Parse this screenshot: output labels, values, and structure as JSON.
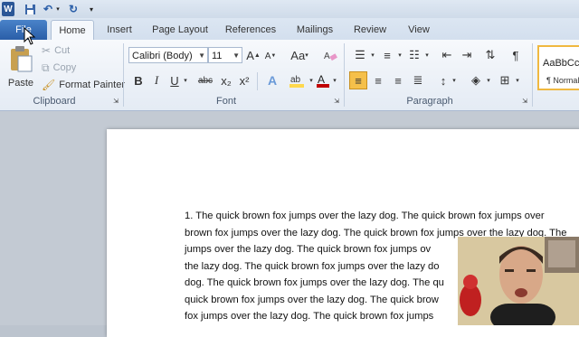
{
  "qat": {
    "app_icon": "W",
    "save_icon": "save-icon",
    "undo_icon": "undo-icon",
    "redo_icon": "redo-icon",
    "customize_icon": "customize-icon"
  },
  "tabs": [
    {
      "label": "File"
    },
    {
      "label": "Home"
    },
    {
      "label": "Insert"
    },
    {
      "label": "Page Layout"
    },
    {
      "label": "References"
    },
    {
      "label": "Mailings"
    },
    {
      "label": "Review"
    },
    {
      "label": "View"
    }
  ],
  "clipboard": {
    "paste": "Paste",
    "cut": "Cut",
    "copy": "Copy",
    "format_painter": "Format Painter",
    "group": "Clipboard"
  },
  "font": {
    "family": "Calibri (Body)",
    "size": "11",
    "group": "Font",
    "bold": "B",
    "italic": "I",
    "underline": "U",
    "strike": "abc",
    "subscript": "x₂",
    "superscript": "x²",
    "case": "Aa",
    "grow": "A",
    "shrink": "A"
  },
  "paragraph": {
    "group": "Paragraph",
    "pilcrow": "¶"
  },
  "styles": {
    "sample": "AaBbCcDc",
    "name": "¶ Normal"
  },
  "document": {
    "lines": [
      "1. The quick brown fox jumps over the lazy dog. The quick brown fox jumps over",
      "brown fox jumps over the lazy dog. The quick brown fox jumps over the lazy dog. The",
      "jumps over the lazy dog. The quick brown fox jumps ov",
      "the lazy dog. The quick brown fox jumps over the lazy do",
      "dog. The quick brown fox jumps over the lazy dog. The qu",
      "quick brown fox jumps over the lazy dog. The quick brow",
      "fox jumps over the lazy dog. The quick brown fox jumps"
    ]
  },
  "colors": {
    "file_tab": "#2a5ea8",
    "ribbon": "#eef3f9",
    "highlight": "#ffd84d",
    "font_color": "#c00000",
    "accent": "#f5c04a"
  }
}
